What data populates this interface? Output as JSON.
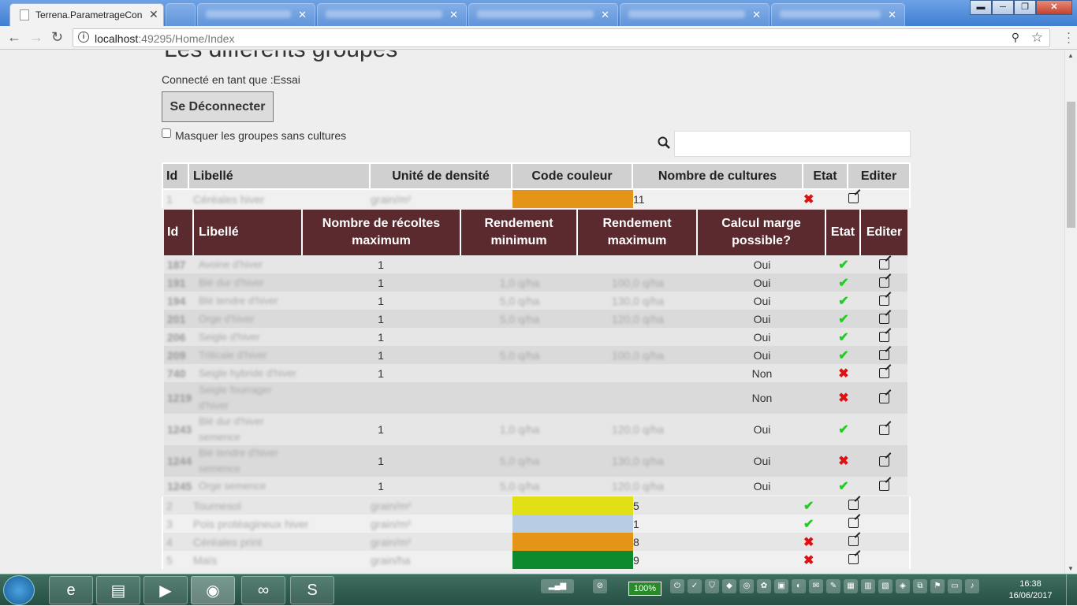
{
  "browser": {
    "active_tab_title": "Terrena.ParametrageCon",
    "url_host": "localhost",
    "url_port": ":49295",
    "url_path": "/Home/Index"
  },
  "page": {
    "title": "Les différents groupes",
    "connected_label": "Connecté en tant que :Essai",
    "logout_label": "Se Déconnecter",
    "hide_groups_label": "Masquer les groupes sans cultures"
  },
  "main_table": {
    "headers": [
      "Id",
      "Libellé",
      "Unité de densité",
      "Code couleur",
      "Nombre de cultures",
      "Etat",
      "Editer"
    ],
    "rows": [
      {
        "id": "1",
        "libelle": "Céréales hiver",
        "unite": "grain/m²",
        "color": "#e49416",
        "nb": "11",
        "etat": "cross"
      },
      {
        "id": "2",
        "libelle": "Tournesol",
        "unite": "grain/m²",
        "color": "#e1e014",
        "nb": "5",
        "etat": "check"
      },
      {
        "id": "3",
        "libelle": "Pois protéagineux hiver",
        "unite": "grain/m²",
        "color": "#b8cce4",
        "nb": "1",
        "etat": "check"
      },
      {
        "id": "4",
        "libelle": "Céréales print",
        "unite": "grain/m²",
        "color": "#e49416",
        "nb": "8",
        "etat": "cross"
      },
      {
        "id": "5",
        "libelle": "Maïs",
        "unite": "grain/ha",
        "color": "#0e8a2e",
        "nb": "9",
        "etat": "cross"
      }
    ]
  },
  "sub_table": {
    "headers": [
      "Id",
      "Libellé",
      "Nombre de récoltes maximum",
      "Rendement minimum",
      "Rendement maximum",
      "Calcul marge possible?",
      "Etat",
      "Editer"
    ],
    "rows": [
      {
        "id": "187",
        "libelle": "Avoine d'hiver",
        "rec": "1",
        "rmin": "",
        "rmax": "",
        "calc": "Oui",
        "etat": "check"
      },
      {
        "id": "191",
        "libelle": "Blé dur d'hiver",
        "rec": "1",
        "rmin": "1,0 q/ha",
        "rmax": "100,0 q/ha",
        "calc": "Oui",
        "etat": "check"
      },
      {
        "id": "194",
        "libelle": "Blé tendre d'hiver",
        "rec": "1",
        "rmin": "5,0 q/ha",
        "rmax": "130,0 q/ha",
        "calc": "Oui",
        "etat": "check"
      },
      {
        "id": "201",
        "libelle": "Orge d'hiver",
        "rec": "1",
        "rmin": "5,0 q/ha",
        "rmax": "120,0 q/ha",
        "calc": "Oui",
        "etat": "check"
      },
      {
        "id": "206",
        "libelle": "Seigle d'hiver",
        "rec": "1",
        "rmin": "",
        "rmax": "",
        "calc": "Oui",
        "etat": "check"
      },
      {
        "id": "209",
        "libelle": "Triticale d'hiver",
        "rec": "1",
        "rmin": "5,0 q/ha",
        "rmax": "100,0 q/ha",
        "calc": "Oui",
        "etat": "check"
      },
      {
        "id": "740",
        "libelle": "Seigle hybride d'hiver",
        "rec": "1",
        "rmin": "",
        "rmax": "",
        "calc": "Non",
        "etat": "cross"
      },
      {
        "id": "1219",
        "libelle": "Seigle fourrager d'hiver",
        "rec": "",
        "rmin": "",
        "rmax": "",
        "calc": "Non",
        "etat": "cross"
      },
      {
        "id": "1243",
        "libelle": "Blé dur d'hiver semence",
        "rec": "1",
        "rmin": "1,0 q/ha",
        "rmax": "120,0 q/ha",
        "calc": "Oui",
        "etat": "check"
      },
      {
        "id": "1244",
        "libelle": "Blé tendre d'hiver semence",
        "rec": "1",
        "rmin": "5,0 q/ha",
        "rmax": "130,0 q/ha",
        "calc": "Oui",
        "etat": "cross"
      },
      {
        "id": "1245",
        "libelle": "Orge semence",
        "rec": "1",
        "rmin": "5,0 q/ha",
        "rmax": "120,0 q/ha",
        "calc": "Oui",
        "etat": "check"
      }
    ]
  },
  "taskbar": {
    "battery": "100%",
    "time": "16:38",
    "date": "16/06/2017"
  }
}
